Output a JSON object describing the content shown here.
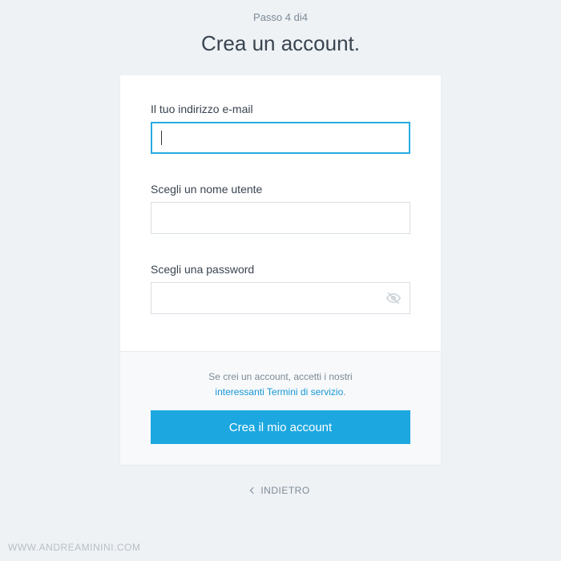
{
  "step_indicator": "Passo 4 di4",
  "page_title": "Crea un account.",
  "fields": {
    "email": {
      "label": "Il tuo indirizzo e-mail",
      "value": ""
    },
    "username": {
      "label": "Scegli un nome utente",
      "value": ""
    },
    "password": {
      "label": "Scegli una password",
      "value": ""
    }
  },
  "footer": {
    "terms_intro": "Se crei un account, accetti i nostri",
    "terms_link": "interessanti Termini di servizio",
    "terms_period": ".",
    "create_button": "Crea il mio account"
  },
  "back_label": "INDIETRO",
  "watermark": "WWW.ANDREAMININI.COM"
}
